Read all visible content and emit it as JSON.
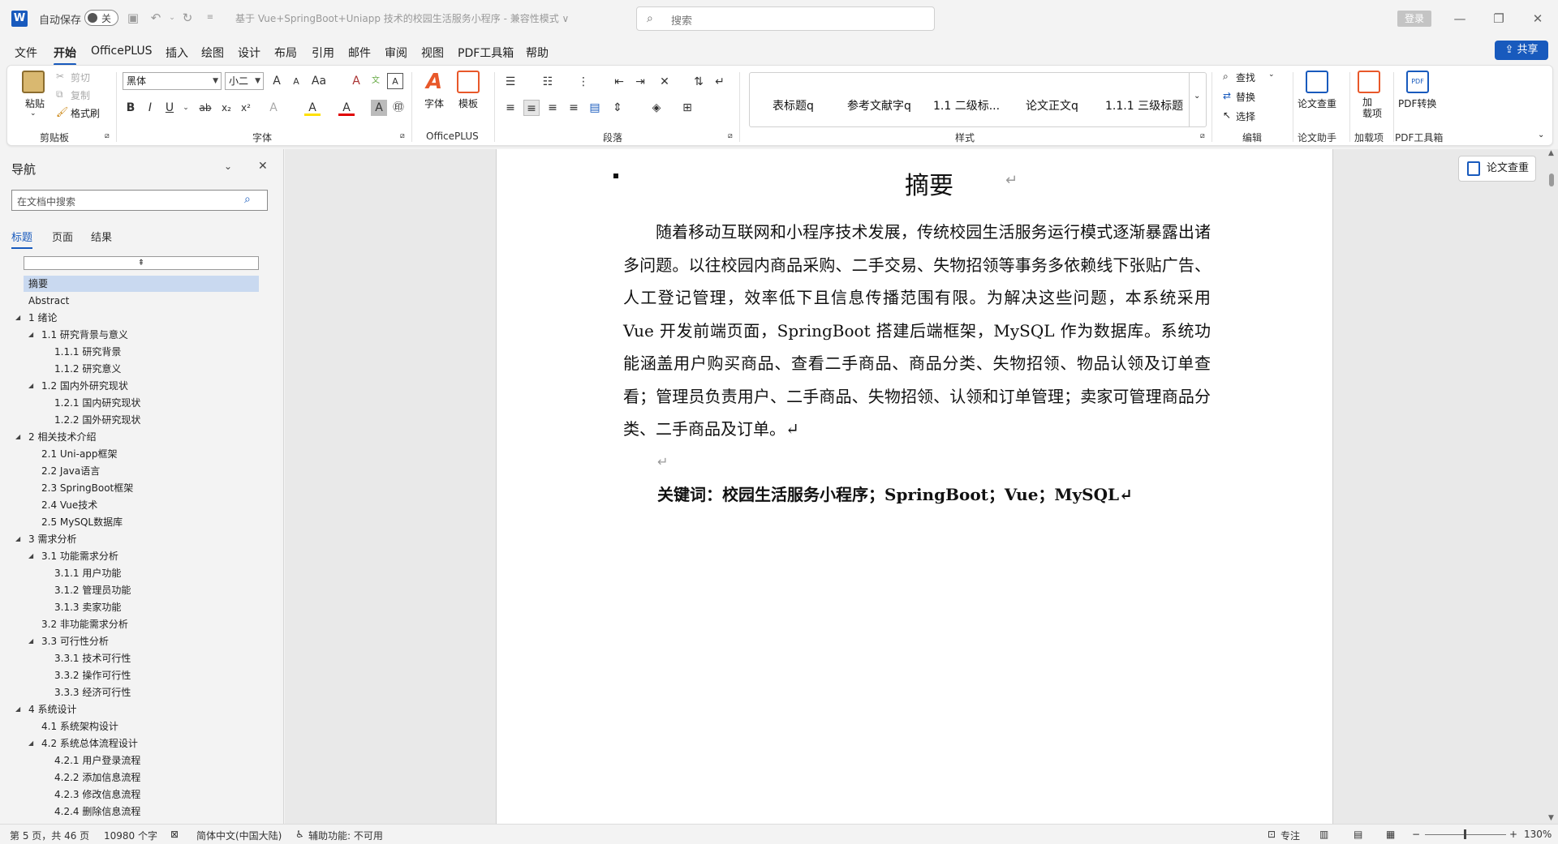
{
  "titlebar": {
    "autosave_label": "自动保存",
    "autosave_state": "关",
    "doc_title": "基于 Vue+SpringBoot+Uniapp 技术的校园生活服务小程序  -  兼容性模式  ∨",
    "search_placeholder": "搜索",
    "login_label": "登录"
  },
  "menu": {
    "tabs": [
      "文件",
      "开始",
      "OfficePLUS",
      "插入",
      "绘图",
      "设计",
      "布局",
      "引用",
      "邮件",
      "审阅",
      "视图",
      "PDF工具箱",
      "帮助"
    ],
    "active": "开始",
    "share_label": "共享"
  },
  "ribbon": {
    "clipboard": {
      "paste": "粘贴",
      "cut": "剪切",
      "copy": "复制",
      "format_painter": "格式刷",
      "group": "剪贴板"
    },
    "font": {
      "name": "黑体",
      "size": "小二",
      "group": "字体",
      "aa": "Aa",
      "b": "B",
      "i": "I",
      "u": "U",
      "strike": "ab",
      "sub": "x₂",
      "sup": "x²",
      "grow": "A",
      "shrink": "A",
      "clear": "A",
      "text_effects": "A",
      "highlight": "A",
      "font_color": "A",
      "char_shade": "A",
      "char_border": "A"
    },
    "officeplus": {
      "font": "字体",
      "template": "模板",
      "group": "OfficePLUS"
    },
    "paragraph": {
      "group": "段落"
    },
    "styles": {
      "items": [
        "表标题q",
        "参考文献字q",
        "1.1  二级标...",
        "论文正文q",
        "1.1.1  三级标题"
      ],
      "group": "样式"
    },
    "editing": {
      "find": "查找",
      "replace": "替换",
      "select": "选择",
      "group": "编辑"
    },
    "thesis": {
      "check": "论文查重",
      "group": "论文助手"
    },
    "addins": {
      "label": "加\n载项",
      "group": "加载项"
    },
    "pdf": {
      "label": "PDF转换",
      "group": "PDF工具箱"
    }
  },
  "nav": {
    "title": "导航",
    "search_placeholder": "在文档中搜索",
    "tabs": [
      "标题",
      "页面",
      "结果"
    ],
    "active_tab": "标题",
    "items": [
      {
        "text": "摘要",
        "level": 0,
        "selected": true,
        "tri": false
      },
      {
        "text": "Abstract",
        "level": 0,
        "selected": false,
        "tri": false
      },
      {
        "text": "1 绪论",
        "level": 0,
        "selected": false,
        "tri": true
      },
      {
        "text": "1.1 研究背景与意义",
        "level": 1,
        "selected": false,
        "tri": true
      },
      {
        "text": "1.1.1 研究背景",
        "level": 2,
        "selected": false,
        "tri": false
      },
      {
        "text": "1.1.2 研究意义",
        "level": 2,
        "selected": false,
        "tri": false
      },
      {
        "text": "1.2 国内外研究现状",
        "level": 1,
        "selected": false,
        "tri": true
      },
      {
        "text": "1.2.1 国内研究现状",
        "level": 2,
        "selected": false,
        "tri": false
      },
      {
        "text": "1.2.2 国外研究现状",
        "level": 2,
        "selected": false,
        "tri": false
      },
      {
        "text": "2 相关技术介绍",
        "level": 0,
        "selected": false,
        "tri": true
      },
      {
        "text": "2.1 Uni-app框架",
        "level": 1,
        "selected": false,
        "tri": false
      },
      {
        "text": "2.2  Java语言",
        "level": 1,
        "selected": false,
        "tri": false
      },
      {
        "text": "2.3  SpringBoot框架",
        "level": 1,
        "selected": false,
        "tri": false
      },
      {
        "text": "2.4  Vue技术",
        "level": 1,
        "selected": false,
        "tri": false
      },
      {
        "text": "2.5  MySQL数据库",
        "level": 1,
        "selected": false,
        "tri": false
      },
      {
        "text": "3 需求分析",
        "level": 0,
        "selected": false,
        "tri": true
      },
      {
        "text": "3.1 功能需求分析",
        "level": 1,
        "selected": false,
        "tri": true
      },
      {
        "text": "3.1.1 用户功能",
        "level": 2,
        "selected": false,
        "tri": false
      },
      {
        "text": "3.1.2 管理员功能",
        "level": 2,
        "selected": false,
        "tri": false
      },
      {
        "text": "3.1.3 卖家功能",
        "level": 2,
        "selected": false,
        "tri": false
      },
      {
        "text": "3.2 非功能需求分析",
        "level": 1,
        "selected": false,
        "tri": false
      },
      {
        "text": "3.3 可行性分析",
        "level": 1,
        "selected": false,
        "tri": true
      },
      {
        "text": "3.3.1 技术可行性",
        "level": 2,
        "selected": false,
        "tri": false
      },
      {
        "text": "3.3.2 操作可行性",
        "level": 2,
        "selected": false,
        "tri": false
      },
      {
        "text": "3.3.3 经济可行性",
        "level": 2,
        "selected": false,
        "tri": false
      },
      {
        "text": "4 系统设计",
        "level": 0,
        "selected": false,
        "tri": true
      },
      {
        "text": "4.1 系统架构设计",
        "level": 1,
        "selected": false,
        "tri": false
      },
      {
        "text": "4.2 系统总体流程设计",
        "level": 1,
        "selected": false,
        "tri": true
      },
      {
        "text": "4.2.1 用户登录流程",
        "level": 2,
        "selected": false,
        "tri": false
      },
      {
        "text": "4.2.2 添加信息流程",
        "level": 2,
        "selected": false,
        "tri": false
      },
      {
        "text": "4.2.3 修改信息流程",
        "level": 2,
        "selected": false,
        "tri": false
      },
      {
        "text": "4.2.4 删除信息流程",
        "level": 2,
        "selected": false,
        "tri": false
      }
    ]
  },
  "document": {
    "heading": "摘要",
    "paragraph_mark": "↵",
    "abstract": "随着移动互联网和小程序技术发展，传统校园生活服务运行模式逐渐暴露出诸多问题。以往校园内商品采购、二手交易、失物招领等事务多依赖线下张贴广告、人工登记管理，效率低下且信息传播范围有限。为解决这些问题，本系统采用 Vue 开发前端页面，SpringBoot 搭建后端框架，MySQL 作为数据库。系统功能涵盖用户购买商品、查看二手商品、商品分类、失物招领、物品认领及订单查看；管理员负责用户、二手商品、失物招领、认领和订单管理；卖家可管理商品分类、二手商品及订单。↵",
    "empty_mark": "↵",
    "keywords": "关键词：校园生活服务小程序；SpringBoot；Vue；MySQL↵",
    "side_tool": "论文查重"
  },
  "status": {
    "page": "第 5 页，共 46 页",
    "words": "10980 个字",
    "language": "简体中文(中国大陆)",
    "accessibility": "辅助功能: 不可用",
    "focus": "专注",
    "zoom": "130%"
  }
}
